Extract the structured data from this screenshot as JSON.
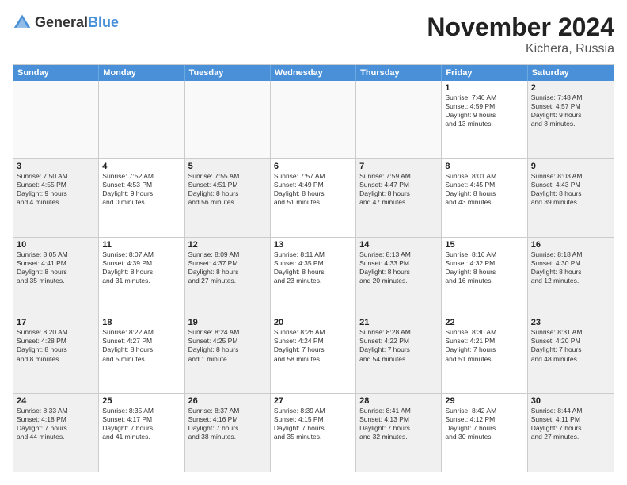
{
  "logo": {
    "general": "General",
    "blue": "Blue"
  },
  "title": "November 2024",
  "location": "Kichera, Russia",
  "header": {
    "days": [
      "Sunday",
      "Monday",
      "Tuesday",
      "Wednesday",
      "Thursday",
      "Friday",
      "Saturday"
    ]
  },
  "rows": [
    [
      {
        "day": "",
        "info": ""
      },
      {
        "day": "",
        "info": ""
      },
      {
        "day": "",
        "info": ""
      },
      {
        "day": "",
        "info": ""
      },
      {
        "day": "",
        "info": ""
      },
      {
        "day": "1",
        "info": "Sunrise: 7:46 AM\nSunset: 4:59 PM\nDaylight: 9 hours\nand 13 minutes."
      },
      {
        "day": "2",
        "info": "Sunrise: 7:48 AM\nSunset: 4:57 PM\nDaylight: 9 hours\nand 8 minutes."
      }
    ],
    [
      {
        "day": "3",
        "info": "Sunrise: 7:50 AM\nSunset: 4:55 PM\nDaylight: 9 hours\nand 4 minutes."
      },
      {
        "day": "4",
        "info": "Sunrise: 7:52 AM\nSunset: 4:53 PM\nDaylight: 9 hours\nand 0 minutes."
      },
      {
        "day": "5",
        "info": "Sunrise: 7:55 AM\nSunset: 4:51 PM\nDaylight: 8 hours\nand 56 minutes."
      },
      {
        "day": "6",
        "info": "Sunrise: 7:57 AM\nSunset: 4:49 PM\nDaylight: 8 hours\nand 51 minutes."
      },
      {
        "day": "7",
        "info": "Sunrise: 7:59 AM\nSunset: 4:47 PM\nDaylight: 8 hours\nand 47 minutes."
      },
      {
        "day": "8",
        "info": "Sunrise: 8:01 AM\nSunset: 4:45 PM\nDaylight: 8 hours\nand 43 minutes."
      },
      {
        "day": "9",
        "info": "Sunrise: 8:03 AM\nSunset: 4:43 PM\nDaylight: 8 hours\nand 39 minutes."
      }
    ],
    [
      {
        "day": "10",
        "info": "Sunrise: 8:05 AM\nSunset: 4:41 PM\nDaylight: 8 hours\nand 35 minutes."
      },
      {
        "day": "11",
        "info": "Sunrise: 8:07 AM\nSunset: 4:39 PM\nDaylight: 8 hours\nand 31 minutes."
      },
      {
        "day": "12",
        "info": "Sunrise: 8:09 AM\nSunset: 4:37 PM\nDaylight: 8 hours\nand 27 minutes."
      },
      {
        "day": "13",
        "info": "Sunrise: 8:11 AM\nSunset: 4:35 PM\nDaylight: 8 hours\nand 23 minutes."
      },
      {
        "day": "14",
        "info": "Sunrise: 8:13 AM\nSunset: 4:33 PM\nDaylight: 8 hours\nand 20 minutes."
      },
      {
        "day": "15",
        "info": "Sunrise: 8:16 AM\nSunset: 4:32 PM\nDaylight: 8 hours\nand 16 minutes."
      },
      {
        "day": "16",
        "info": "Sunrise: 8:18 AM\nSunset: 4:30 PM\nDaylight: 8 hours\nand 12 minutes."
      }
    ],
    [
      {
        "day": "17",
        "info": "Sunrise: 8:20 AM\nSunset: 4:28 PM\nDaylight: 8 hours\nand 8 minutes."
      },
      {
        "day": "18",
        "info": "Sunrise: 8:22 AM\nSunset: 4:27 PM\nDaylight: 8 hours\nand 5 minutes."
      },
      {
        "day": "19",
        "info": "Sunrise: 8:24 AM\nSunset: 4:25 PM\nDaylight: 8 hours\nand 1 minute."
      },
      {
        "day": "20",
        "info": "Sunrise: 8:26 AM\nSunset: 4:24 PM\nDaylight: 7 hours\nand 58 minutes."
      },
      {
        "day": "21",
        "info": "Sunrise: 8:28 AM\nSunset: 4:22 PM\nDaylight: 7 hours\nand 54 minutes."
      },
      {
        "day": "22",
        "info": "Sunrise: 8:30 AM\nSunset: 4:21 PM\nDaylight: 7 hours\nand 51 minutes."
      },
      {
        "day": "23",
        "info": "Sunrise: 8:31 AM\nSunset: 4:20 PM\nDaylight: 7 hours\nand 48 minutes."
      }
    ],
    [
      {
        "day": "24",
        "info": "Sunrise: 8:33 AM\nSunset: 4:18 PM\nDaylight: 7 hours\nand 44 minutes."
      },
      {
        "day": "25",
        "info": "Sunrise: 8:35 AM\nSunset: 4:17 PM\nDaylight: 7 hours\nand 41 minutes."
      },
      {
        "day": "26",
        "info": "Sunrise: 8:37 AM\nSunset: 4:16 PM\nDaylight: 7 hours\nand 38 minutes."
      },
      {
        "day": "27",
        "info": "Sunrise: 8:39 AM\nSunset: 4:15 PM\nDaylight: 7 hours\nand 35 minutes."
      },
      {
        "day": "28",
        "info": "Sunrise: 8:41 AM\nSunset: 4:13 PM\nDaylight: 7 hours\nand 32 minutes."
      },
      {
        "day": "29",
        "info": "Sunrise: 8:42 AM\nSunset: 4:12 PM\nDaylight: 7 hours\nand 30 minutes."
      },
      {
        "day": "30",
        "info": "Sunrise: 8:44 AM\nSunset: 4:11 PM\nDaylight: 7 hours\nand 27 minutes."
      }
    ]
  ]
}
